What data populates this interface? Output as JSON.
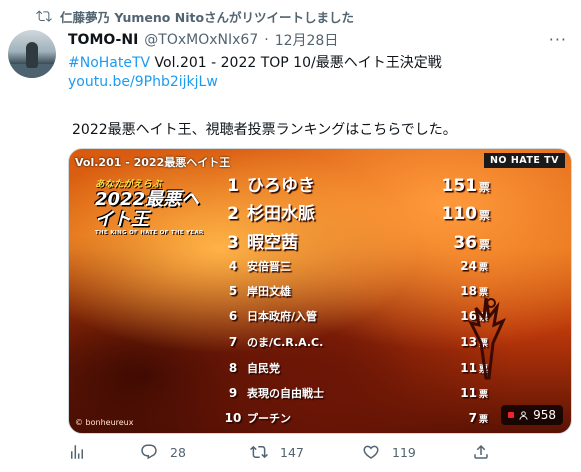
{
  "retweet": {
    "text": "仁藤夢乃 Yumeno Nitoさんがリツイートしました"
  },
  "tweet": {
    "name": "TOMO-NI",
    "handle": "@TOxMOxNIx67",
    "sep": "·",
    "date": "12月28日",
    "line1_tag": "#NoHateTV",
    "line1_text": " Vol.201 - 2022 TOP 10/最悪ヘイト王決定戦",
    "line2_link": "youtu.be/9Phb2ijkjLw",
    "line3_text": "2022最悪ヘイト王、視聴者投票ランキングはこちらでした。"
  },
  "media": {
    "title_overlay": "Vol.201 - 2022最悪ヘイト王",
    "badge": "NO HATE TV",
    "logo_sub": "あなたがえらぶ",
    "logo_main": "2022最悪ヘイト王",
    "logo_eng": "THE KING OF HATE OF THE YEAR",
    "credit": "© bonheureux",
    "views": "958",
    "unit": "票",
    "ranking": [
      {
        "rank": "1",
        "name": "ひろゆき",
        "votes": "151"
      },
      {
        "rank": "2",
        "name": "杉田水脈",
        "votes": "110"
      },
      {
        "rank": "3",
        "name": "暇空茜",
        "votes": "36"
      },
      {
        "rank": "4",
        "name": "安倍晋三",
        "votes": "24"
      },
      {
        "rank": "5",
        "name": "岸田文雄",
        "votes": "18"
      },
      {
        "rank": "6",
        "name": "日本政府/入管",
        "votes": "16"
      },
      {
        "rank": "7",
        "name": "のま/C.R.A.C.",
        "votes": "13"
      },
      {
        "rank": "8",
        "name": "自民党",
        "votes": "11"
      },
      {
        "rank": "9",
        "name": "表現の自由戦士",
        "votes": "11"
      },
      {
        "rank": "10",
        "name": "プーチン",
        "votes": "7"
      }
    ]
  },
  "actions": {
    "reply_count": "28",
    "retweet_count": "147",
    "like_count": "119"
  },
  "colors": {
    "link": "#1d9bf0",
    "muted": "#536471"
  }
}
